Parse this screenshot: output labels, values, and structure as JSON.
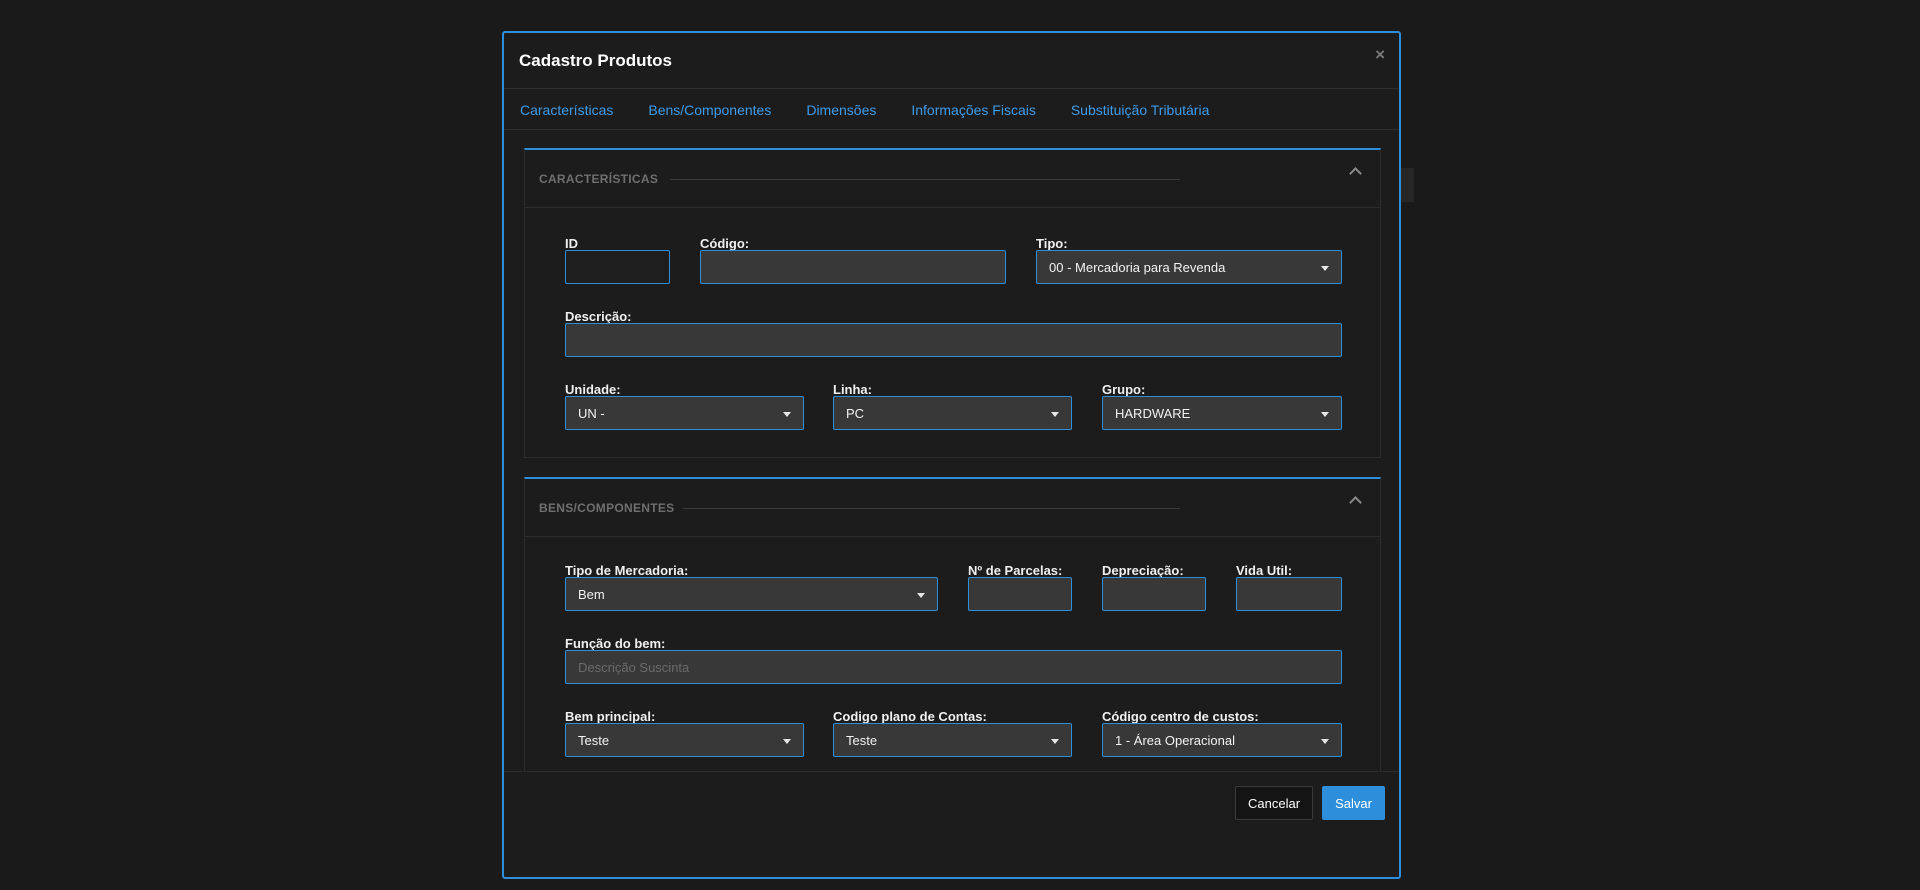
{
  "modal": {
    "title": "Cadastro Produtos",
    "close_icon": "close-icon"
  },
  "tabs": [
    {
      "label": "Características"
    },
    {
      "label": "Bens/Componentes"
    },
    {
      "label": "Dimensões"
    },
    {
      "label": "Informações Fiscais"
    },
    {
      "label": "Substituição Tributária"
    }
  ],
  "caracteristicas": {
    "title": "CARACTERÍSTICAS",
    "id": {
      "label": "ID",
      "value": ""
    },
    "codigo": {
      "label": "Código:",
      "value": ""
    },
    "tipo": {
      "label": "Tipo:",
      "value": "00 - Mercadoria para Revenda"
    },
    "descricao": {
      "label": "Descrição:",
      "value": ""
    },
    "unidade": {
      "label": "Unidade:",
      "value": "UN -"
    },
    "linha": {
      "label": "Linha:",
      "value": "PC"
    },
    "grupo": {
      "label": "Grupo:",
      "value": "HARDWARE"
    }
  },
  "bens": {
    "title": "BENS/COMPONENTES",
    "tipo_mercadoria": {
      "label": "Tipo de Mercadoria:",
      "value": "Bem"
    },
    "parcelas": {
      "label": "Nº de Parcelas:",
      "value": ""
    },
    "depreciacao": {
      "label": "Depreciação:",
      "value": ""
    },
    "vida_util": {
      "label": "Vida Util:",
      "value": ""
    },
    "funcao": {
      "label": "Função do bem:",
      "placeholder": "Descrição Suscinta",
      "value": ""
    },
    "bem_principal": {
      "label": "Bem principal:",
      "value": "Teste"
    },
    "plano_contas": {
      "label": "Codigo plano de Contas:",
      "value": "Teste"
    },
    "centro_custos": {
      "label": "Código centro de custos:",
      "value": "1 - Área Operacional"
    }
  },
  "footer": {
    "cancel_label": "Cancelar",
    "save_label": "Salvar"
  },
  "colors": {
    "accent": "#2d8fdc",
    "background": "#1b1b1b",
    "field_bg": "#383838"
  }
}
